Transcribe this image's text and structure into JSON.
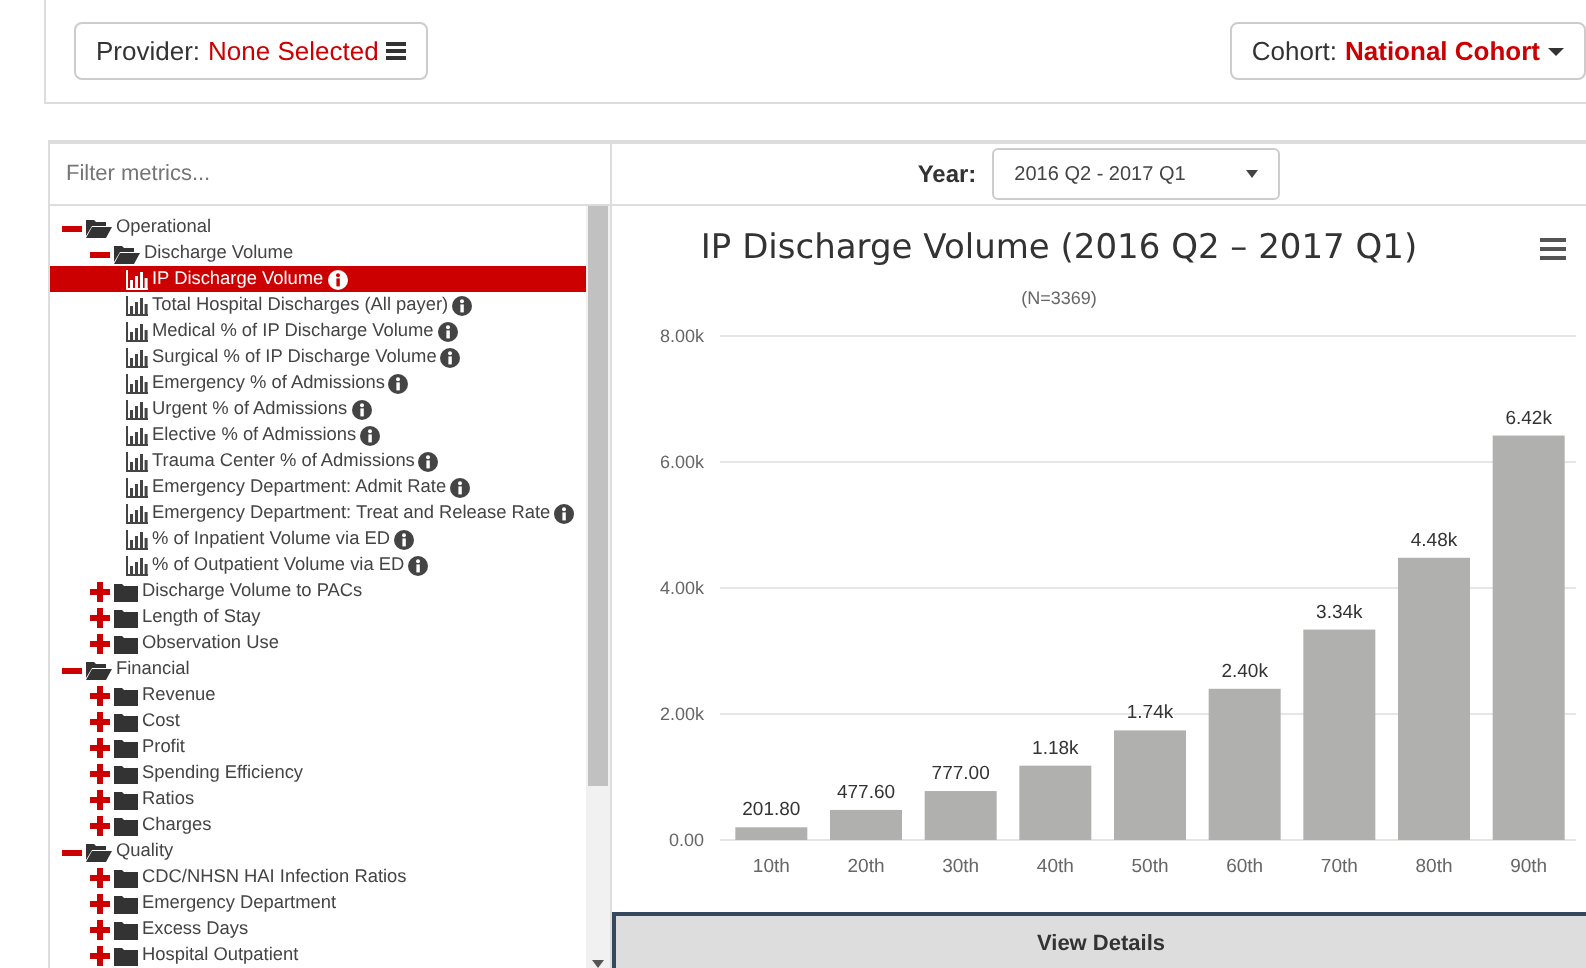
{
  "header": {
    "provider": {
      "label": "Provider:",
      "value": "None Selected"
    },
    "cohort": {
      "label": "Cohort:",
      "value": "National Cohort"
    }
  },
  "filter": {
    "placeholder": "Filter metrics..."
  },
  "tree": [
    {
      "kind": "group",
      "label": "Operational",
      "expanded": true,
      "children": [
        {
          "kind": "group",
          "label": "Discharge Volume",
          "expanded": true,
          "children": [
            {
              "kind": "metric",
              "label": "IP Discharge Volume",
              "selected": true
            },
            {
              "kind": "metric",
              "label": "Total Hospital Discharges (All payer)",
              "selected": false
            },
            {
              "kind": "metric",
              "label": "Medical % of IP Discharge Volume",
              "selected": false
            },
            {
              "kind": "metric",
              "label": "Surgical % of IP Discharge Volume",
              "selected": false
            },
            {
              "kind": "metric",
              "label": "Emergency % of Admissions",
              "selected": false
            },
            {
              "kind": "metric",
              "label": "Urgent % of Admissions",
              "selected": false
            },
            {
              "kind": "metric",
              "label": "Elective % of Admissions",
              "selected": false
            },
            {
              "kind": "metric",
              "label": "Trauma Center % of Admissions",
              "selected": false
            },
            {
              "kind": "metric",
              "label": "Emergency Department: Admit Rate",
              "selected": false
            },
            {
              "kind": "metric",
              "label": "Emergency Department: Treat and Release Rate",
              "selected": false
            },
            {
              "kind": "metric",
              "label": "% of Inpatient Volume via ED",
              "selected": false
            },
            {
              "kind": "metric",
              "label": "% of Outpatient Volume via ED",
              "selected": false
            }
          ]
        },
        {
          "kind": "group",
          "label": "Discharge Volume to PACs",
          "expanded": false
        },
        {
          "kind": "group",
          "label": "Length of Stay",
          "expanded": false
        },
        {
          "kind": "group",
          "label": "Observation Use",
          "expanded": false
        }
      ]
    },
    {
      "kind": "group",
      "label": "Financial",
      "expanded": true,
      "children": [
        {
          "kind": "group",
          "label": "Revenue",
          "expanded": false
        },
        {
          "kind": "group",
          "label": "Cost",
          "expanded": false
        },
        {
          "kind": "group",
          "label": "Profit",
          "expanded": false
        },
        {
          "kind": "group",
          "label": "Spending Efficiency",
          "expanded": false
        },
        {
          "kind": "group",
          "label": "Ratios",
          "expanded": false
        },
        {
          "kind": "group",
          "label": "Charges",
          "expanded": false
        }
      ]
    },
    {
      "kind": "group",
      "label": "Quality",
      "expanded": true,
      "children": [
        {
          "kind": "group",
          "label": "CDC/NHSN HAI Infection Ratios",
          "expanded": false
        },
        {
          "kind": "group",
          "label": "Emergency Department",
          "expanded": false
        },
        {
          "kind": "group",
          "label": "Excess Days",
          "expanded": false
        },
        {
          "kind": "group",
          "label": "Hospital Outpatient",
          "expanded": false
        }
      ]
    }
  ],
  "year": {
    "label": "Year:",
    "value": "2016 Q2 - 2017 Q1"
  },
  "chart": {
    "subtitle": "(N=3369)",
    "chart_data": {
      "type": "bar",
      "title": "IP Discharge Volume (2016 Q2 – 2017 Q1)",
      "categories": [
        "10th",
        "20th",
        "30th",
        "40th",
        "50th",
        "60th",
        "70th",
        "80th",
        "90th"
      ],
      "series": [
        {
          "color": "#b0b1ae",
          "values": [
            201.8,
            477.6,
            777,
            1180,
            1740,
            2400,
            3340,
            4480,
            6420
          ]
        }
      ],
      "value_labels": [
        "201.80",
        "477.60",
        "777.00",
        "1.18k",
        "1.74k",
        "2.40k",
        "3.34k",
        "4.48k",
        "6.42k"
      ],
      "ylim": [
        0,
        8000
      ],
      "grid": true,
      "yticks": [
        {
          "value": 0,
          "label": "0.00"
        },
        {
          "value": 2000,
          "label": "2.00k"
        },
        {
          "value": 4000,
          "label": "4.00k"
        },
        {
          "value": 6000,
          "label": "6.00k"
        },
        {
          "value": 8000,
          "label": "8.00k"
        }
      ]
    }
  },
  "view_details": "View Details"
}
